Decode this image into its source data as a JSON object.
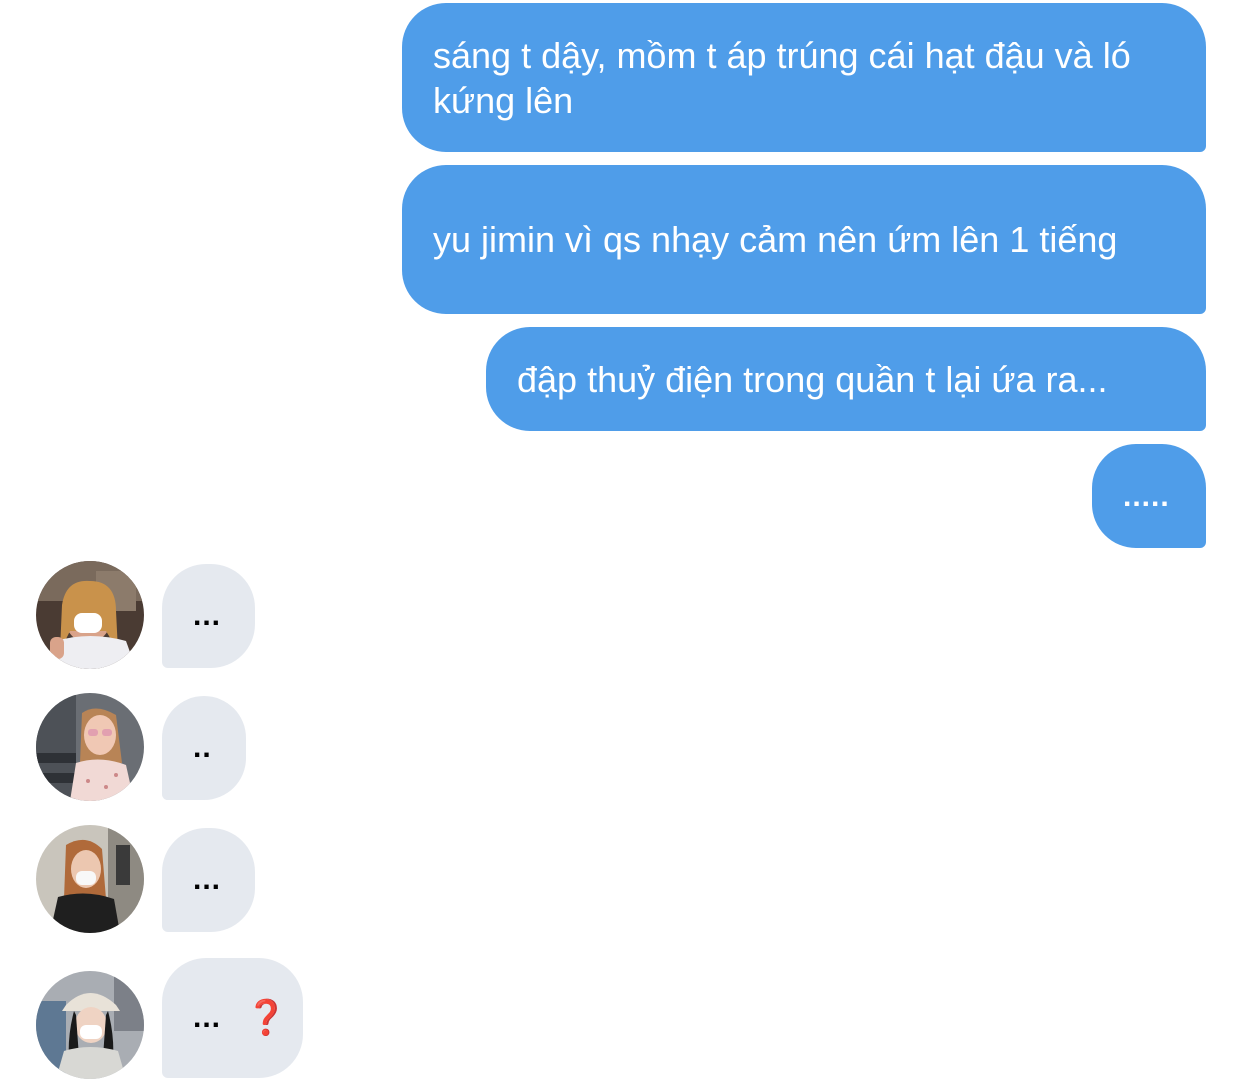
{
  "outgoing": [
    {
      "text": "sáng t dậy, mồm t áp trúng cái hạt đậu và ló kứng lên"
    },
    {
      "text": "yu jimin vì qs nhạy cảm nên ứm lên 1 tiếng"
    },
    {
      "text": "đập thuỷ điện trong quần t lại ứa ra..."
    },
    {
      "text": "....."
    }
  ],
  "incoming": [
    {
      "text": "...",
      "avatar": "avatar-girl-white-shirt-mask"
    },
    {
      "text": "..",
      "avatar": "avatar-girl-pink-sunglasses"
    },
    {
      "text": "...",
      "avatar": "avatar-girl-black-coat-mask"
    },
    {
      "text": "...",
      "emoji": "❓",
      "avatar": "avatar-girl-bucket-hat-mask"
    }
  ],
  "colors": {
    "outgoing_bubble": "#4f9de9",
    "incoming_bubble": "#e5e9ef",
    "question_mark": "#d0302f"
  }
}
